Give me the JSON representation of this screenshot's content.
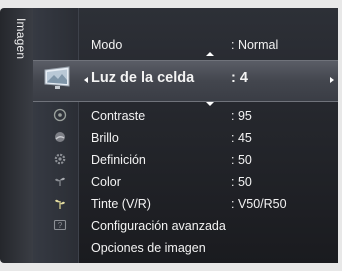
{
  "side_tab": {
    "label": "Imagen"
  },
  "menu": {
    "items": [
      {
        "label": "Modo",
        "value": ": Normal"
      },
      {
        "label": "Luz de la celda",
        "value": ": 4",
        "selected": true
      },
      {
        "label": "Contraste",
        "value": ": 95"
      },
      {
        "label": "Brillo",
        "value": ": 45"
      },
      {
        "label": "Definición",
        "value": ": 50"
      },
      {
        "label": "Color",
        "value": ": 50"
      },
      {
        "label": "Tinte (V/R)",
        "value": ": V50/R50"
      },
      {
        "label": "Configuración avanzada",
        "value": ""
      },
      {
        "label": "Opciones de imagen",
        "value": ""
      }
    ]
  },
  "icons": [
    "tv-picture-icon",
    "disc-icon",
    "satellite-icon",
    "gear-icon",
    "sprout-icon",
    "plant-icon",
    "help-icon"
  ],
  "colors": {
    "panel": "#1f2126",
    "selected_row": "#4c4f57",
    "text": "#f3f3f3",
    "arrow": "#ffffff"
  }
}
